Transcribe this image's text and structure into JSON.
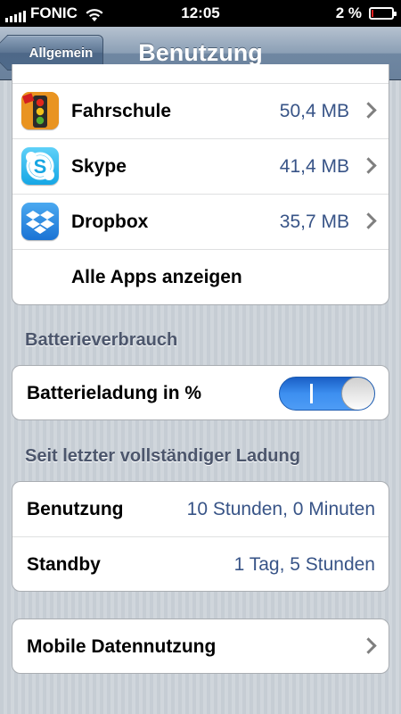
{
  "status_bar": {
    "carrier": "FONIC",
    "time": "12:05",
    "battery_text": "2 %",
    "battery_level": 0.02
  },
  "nav": {
    "back_label": "Allgemein",
    "title": "Benutzung"
  },
  "apps": [
    {
      "name": "Fahrschule",
      "size": "50,4 MB",
      "icon": "traffic-light-icon"
    },
    {
      "name": "Skype",
      "size": "41,4 MB",
      "icon": "skype-icon"
    },
    {
      "name": "Dropbox",
      "size": "35,7 MB",
      "icon": "dropbox-icon"
    }
  ],
  "show_all_apps": "Alle Apps anzeigen",
  "battery_section": {
    "header": "Batterieverbrauch",
    "percent_label": "Batterieladung in %",
    "percent_toggle_on": true
  },
  "since_charge": {
    "header": "Seit letzter vollständiger Ladung",
    "usage_label": "Benutzung",
    "usage_value": "10 Stunden, 0 Minuten",
    "standby_label": "Standby",
    "standby_value": "1 Tag, 5 Stunden"
  },
  "mobile_data": {
    "label": "Mobile Datennutzung"
  },
  "colors": {
    "value_text": "#385487",
    "toggle_on": "#3d8ff0",
    "battery_low": "#e02020"
  }
}
